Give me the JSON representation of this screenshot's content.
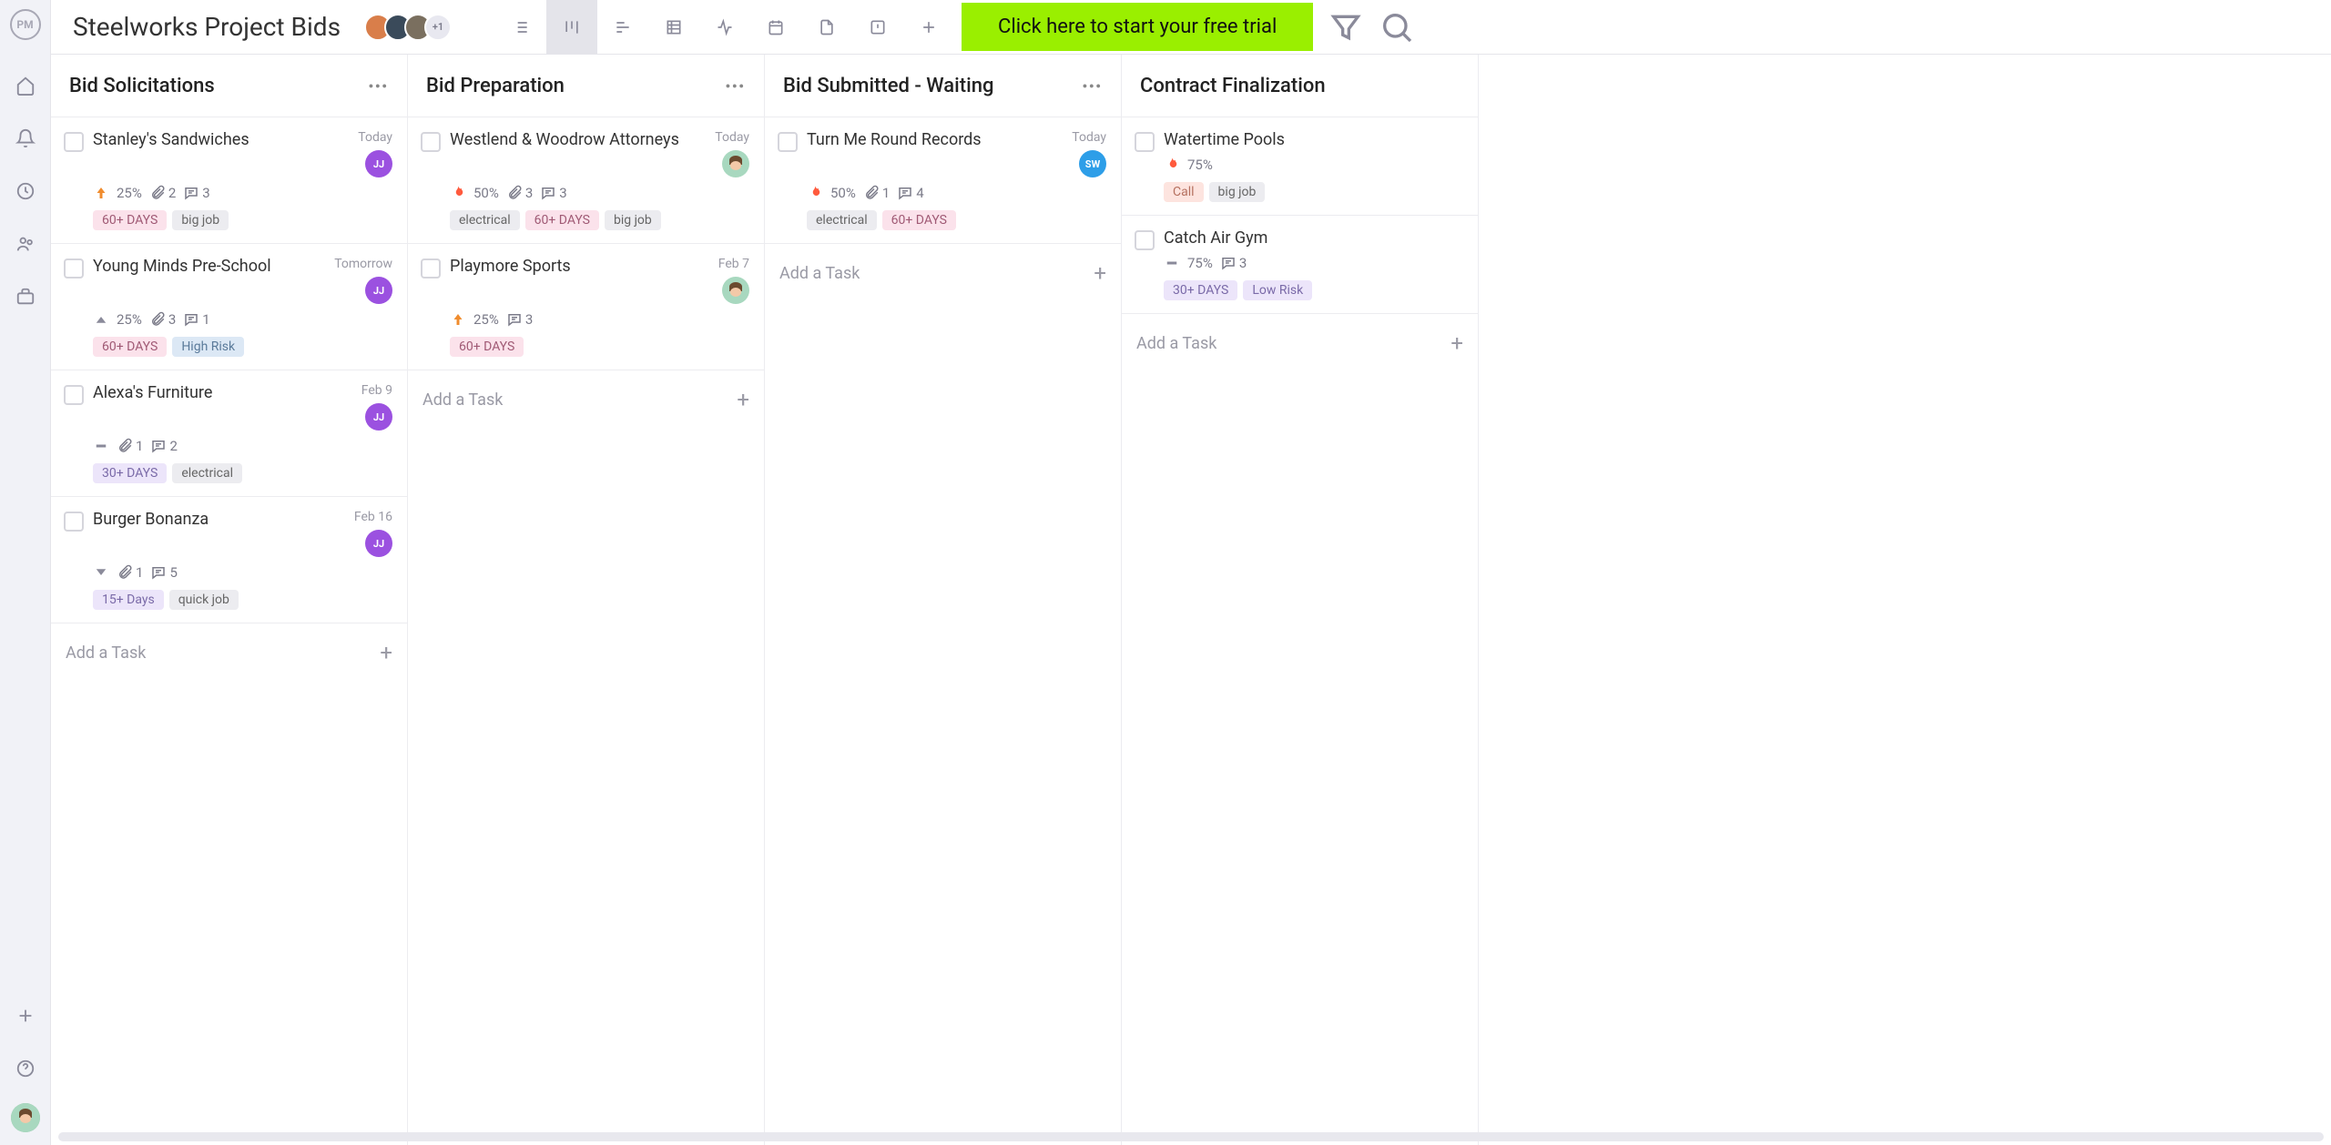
{
  "header": {
    "logo_text": "PM",
    "project_title": "Steelworks Project Bids",
    "avatars": [
      {
        "bg": "#d97e4a"
      },
      {
        "bg": "#3a4a5a"
      },
      {
        "bg": "#7a6f5f"
      }
    ],
    "avatar_more": "+1",
    "trial_banner": "Click here to start your free trial"
  },
  "add_task_label": "Add a Task",
  "columns": [
    {
      "title": "Bid Solicitations",
      "show_more": true,
      "cards": [
        {
          "title": "Stanley's Sandwiches",
          "date": "Today",
          "avatar": {
            "label": "JJ",
            "bg": "#9b51e0"
          },
          "priority": "arrow-up",
          "priority_color": "#f08c2e",
          "progress": "25%",
          "attachments": "2",
          "comments": "3",
          "tags": [
            {
              "text": "60+ DAYS",
              "cls": "pink"
            },
            {
              "text": "big job",
              "cls": ""
            }
          ]
        },
        {
          "title": "Young Minds Pre-School",
          "date": "Tomorrow",
          "avatar": {
            "label": "JJ",
            "bg": "#9b51e0"
          },
          "priority": "triangle-up",
          "priority_color": "#8a8a9a",
          "progress": "25%",
          "attachments": "3",
          "comments": "1",
          "tags": [
            {
              "text": "60+ DAYS",
              "cls": "pink"
            },
            {
              "text": "High Risk",
              "cls": "blue"
            }
          ]
        },
        {
          "title": "Alexa's Furniture",
          "date": "Feb 9",
          "avatar": {
            "label": "JJ",
            "bg": "#9b51e0"
          },
          "priority": "dash",
          "priority_color": "#8a8a9a",
          "progress": "",
          "attachments": "1",
          "comments": "2",
          "tags": [
            {
              "text": "30+ DAYS",
              "cls": "lav"
            },
            {
              "text": "electrical",
              "cls": ""
            }
          ]
        },
        {
          "title": "Burger Bonanza",
          "date": "Feb 16",
          "avatar": {
            "label": "JJ",
            "bg": "#9b51e0"
          },
          "priority": "triangle-down",
          "priority_color": "#8a8a9a",
          "progress": "",
          "attachments": "1",
          "comments": "5",
          "tags": [
            {
              "text": "15+ Days",
              "cls": "lav"
            },
            {
              "text": "quick job",
              "cls": ""
            }
          ]
        }
      ]
    },
    {
      "title": "Bid Preparation",
      "show_more": true,
      "cards": [
        {
          "title": "Westlend & Woodrow Attorneys",
          "date": "Today",
          "avatar": {
            "label": "",
            "bg": "face"
          },
          "priority": "fire",
          "priority_color": "#ff5a3d",
          "progress": "50%",
          "attachments": "3",
          "comments": "3",
          "tags": [
            {
              "text": "electrical",
              "cls": ""
            },
            {
              "text": "60+ DAYS",
              "cls": "pink"
            },
            {
              "text": "big job",
              "cls": ""
            }
          ]
        },
        {
          "title": "Playmore Sports",
          "date": "Feb 7",
          "avatar": {
            "label": "",
            "bg": "face"
          },
          "priority": "arrow-up",
          "priority_color": "#f08c2e",
          "progress": "25%",
          "attachments": "",
          "comments": "3",
          "tags": [
            {
              "text": "60+ DAYS",
              "cls": "pink"
            }
          ]
        }
      ]
    },
    {
      "title": "Bid Submitted - Waiting",
      "show_more": true,
      "cards": [
        {
          "title": "Turn Me Round Records",
          "date": "Today",
          "avatar": {
            "label": "SW",
            "bg": "#2d9ee8"
          },
          "priority": "fire",
          "priority_color": "#ff5a3d",
          "progress": "50%",
          "attachments": "1",
          "comments": "4",
          "tags": [
            {
              "text": "electrical",
              "cls": ""
            },
            {
              "text": "60+ DAYS",
              "cls": "pink"
            }
          ]
        }
      ]
    },
    {
      "title": "Contract Finalization",
      "show_more": false,
      "cards": [
        {
          "title": "Watertime Pools",
          "date": "",
          "avatar": null,
          "priority": "fire",
          "priority_color": "#ff5a3d",
          "progress": "75%",
          "attachments": "",
          "comments": "",
          "tags": [
            {
              "text": "Call",
              "cls": "salmon"
            },
            {
              "text": "big job",
              "cls": ""
            }
          ]
        },
        {
          "title": "Catch Air Gym",
          "date": "",
          "avatar": null,
          "priority": "dash",
          "priority_color": "#8a8a9a",
          "progress": "75%",
          "attachments": "",
          "comments": "3",
          "tags": [
            {
              "text": "30+ DAYS",
              "cls": "lav"
            },
            {
              "text": "Low Risk",
              "cls": "lav"
            }
          ]
        }
      ]
    }
  ]
}
